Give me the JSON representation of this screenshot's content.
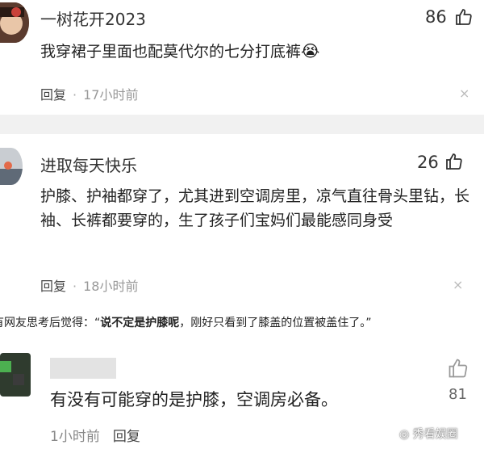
{
  "comments": [
    {
      "username": "一树花开2023",
      "likes": "86",
      "text": "我穿裙子里面也配莫代尔的七分打底裤",
      "emoji": "😭",
      "reply_label": "回复",
      "time": "17小时前",
      "close": "×"
    },
    {
      "username": "进取每天快乐",
      "likes": "26",
      "text": "护膝、护袖都穿了，尤其进到空调房里，凉气直往骨头里钻，长袖、长裤都要穿的，生了孩子们宝妈们最能感同身受",
      "reply_label": "回复",
      "time": "18小时前",
      "close": "×"
    }
  ],
  "caption": {
    "prefix": "有网友思考后觉得：“",
    "bold": "说不定是护膝呢",
    "suffix": "，刚好只看到了膝盖的位置被盖住了。”"
  },
  "comment3": {
    "text": "有没有可能穿的是护膝，空调房必备。",
    "likes": "81",
    "time": "1小时前",
    "reply_label": "回复"
  },
  "watermark": "秀看娱圈",
  "colors": {
    "text": "#222222",
    "meta": "#666666",
    "divider": "#f1f1f1"
  }
}
